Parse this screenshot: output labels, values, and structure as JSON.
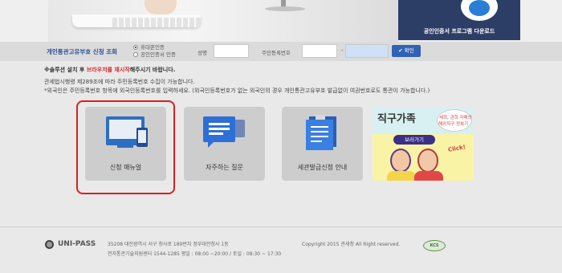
{
  "banner": {
    "cert_download": "공인인증서 프로그램 다운로드"
  },
  "search": {
    "title": "개인통관고유부호 신청 조회",
    "radio_options": [
      "휴대폰인증",
      "공인인증서 인증"
    ],
    "name_label": "성명",
    "resident_label": "주민등록번호",
    "dash": "-",
    "confirm_label": "확인"
  },
  "notices": {
    "line1_prefix": "※솔루션 설치 후 ",
    "line1_highlight": "브라우저를 재시작",
    "line1_suffix": "해주시기 바랍니다.",
    "line2": "관세법시행령 제289조에 따라 주민등록번호 수집이 가능합니다.",
    "line3": "*외국인은 주민등록번호 항목에 외국인등록번호를 입력하세요.  (외국인등록번호가 없는 외국인의 경우 개인통관고유부호 발급없이 여권번호로도 통관이 가능합니다.)"
  },
  "tiles": [
    {
      "label": "신청 매뉴얼"
    },
    {
      "label": "자주하는 질문"
    },
    {
      "label": "세관발급신청 안내"
    }
  ],
  "promo": {
    "title": "직구가족",
    "sub1": "세희, 관희 자매의",
    "sub2": "해외직구 정복기",
    "button": "보러가기",
    "click": "Click!"
  },
  "footer": {
    "logo": "UNI-PASS",
    "address": "35208 대전광역시 서구 청사로 189번지 정부대전청사 1동",
    "contact": "전자통관기술지원센터   1544-1285 평일 : 08:00 ~20:00 / 토일 : 08:30 ~ 17:30",
    "copyright": "Copyright 2015 관세청 All Right reserved.",
    "badge": "KCS"
  },
  "colors": {
    "accent_blue": "#2f63b4",
    "highlight_red": "#d92020",
    "cert_panel": "#2d3e66"
  }
}
